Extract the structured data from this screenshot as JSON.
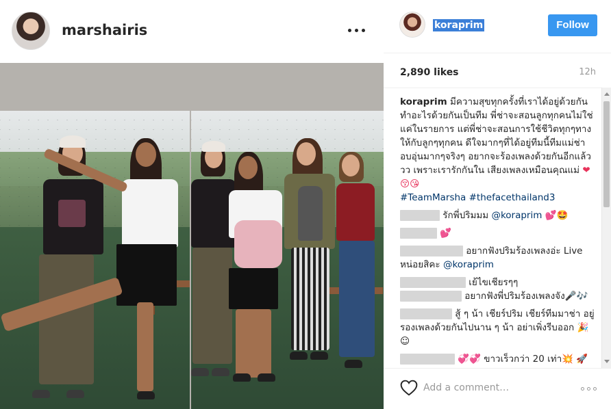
{
  "post_owner": {
    "username": "marshairis"
  },
  "author": {
    "username": "koraprim"
  },
  "follow_label": "Follow",
  "likes": "2,890 likes",
  "time": "12h",
  "caption": {
    "user": "koraprim",
    "text": "มีความสุขทุกครั้งที่เราได้อยู่ด้วยกัน ทำอะไรด้วยกันเป็นทีม พี่ช่าจะสอนลูกทุกคนไม่ใช่แค่ในรายการ แต่พี่ช่าจะสอนการใช้ชีวิตทุกๆทางให้กับลูกๆทุกคน ดีใจมากๆที่ได้อยู่ทีมนี้ทีมแม่ช่า อบอุ่นมากๆจริงๆ อยากจะร้องเพลงด้วยกันอีกแล้ววว เพราะเรารักกันใน เสียงเพลงเหมือนคุณแม่",
    "emoji": "❤😚😘",
    "hashtags": "#TeamMarsha #thefacethailand3"
  },
  "comments": [
    {
      "text": "รักพี่ปริมมม",
      "mention": "@koraprim",
      "emoji": "💕🤩"
    },
    {
      "text": "",
      "mention": "",
      "emoji": "💕"
    },
    {
      "text": "อยากฟังปริมร้องเพลงอ่ะ Live หน่อยสิคะ",
      "mention": "@koraprim",
      "emoji": ""
    },
    {
      "text": "เย้ไขเชียรๆๆ",
      "mention": "",
      "emoji": ""
    },
    {
      "text": "อยากฟังพี่ปริมร้องเพลงจัง🎤🎶",
      "mention": "",
      "emoji": ""
    },
    {
      "text": "สู้ ๆ น้า เชียร์ปริม เชียร์ทีมมาช่า อยู่รองเพลงด้วยกันไปนาน ๆ น้า อย่าเพิ่งรีบออก 🎉 ☺",
      "mention": "",
      "emoji": ""
    },
    {
      "text": "ขาวเร็วกว่า 20 เท่า💥 🚀",
      "mention": "",
      "emoji": "💞💞"
    }
  ],
  "add_comment_placeholder": "Add a comment…",
  "icons": {
    "more": "more-options-icon",
    "like": "heart-icon",
    "options": "options-icon"
  },
  "colors": {
    "follow_bg": "#3897f0",
    "hashtag": "#003569"
  }
}
